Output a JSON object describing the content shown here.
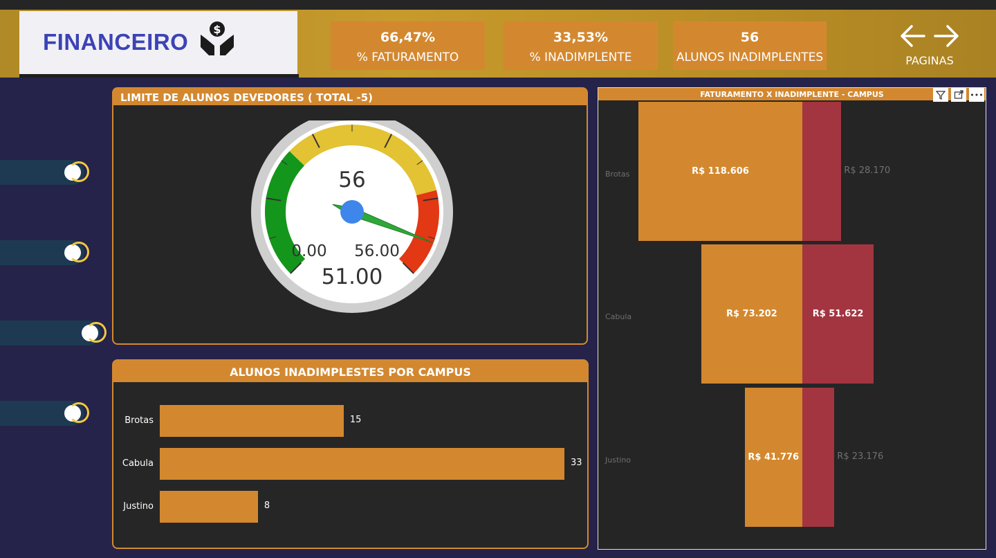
{
  "header": {
    "title": "FINANCEIRO",
    "kpis": [
      {
        "value": "66,47%",
        "label": "% FATURAMENTO"
      },
      {
        "value": "33,53%",
        "label": "% INADIMPLENTE"
      },
      {
        "value": "56",
        "label": "ALUNOS INADIMPLENTES"
      }
    ],
    "nav_label": "PAGINAS"
  },
  "gauge": {
    "title": "LIMITE DE ALUNOS DEVEDORES ( TOTAL  -5)",
    "value": "56",
    "min_label": "0.00",
    "max_label": "56.00",
    "target_label": "51.00",
    "min": 0,
    "max": 56,
    "current": 56,
    "target": 51
  },
  "bar_panel": {
    "title": "ALUNOS INADIMPLESTES POR CAMPUS"
  },
  "chart_data": [
    {
      "type": "bar",
      "title": "ALUNOS INADIMPLESTES POR CAMPUS",
      "categories": [
        "Brotas",
        "Cabula",
        "Justino"
      ],
      "values": [
        15,
        33,
        8
      ],
      "value_labels": [
        "15",
        "33",
        "8"
      ],
      "orientation": "horizontal"
    },
    {
      "type": "bar",
      "title": "FATURAMENTO X INADIMPLENTE - CAMPUS",
      "categories": [
        "Brotas",
        "Cabula",
        "Justino"
      ],
      "series": [
        {
          "values": [
            118606,
            73202,
            41776
          ],
          "labels": [
            "R$ 118.606",
            "R$ 73.202",
            "R$ 41.776"
          ],
          "color": "#d3882f"
        },
        {
          "values": [
            28170,
            51622,
            23176
          ],
          "labels": [
            "R$ 28.170",
            "R$ 51.622",
            "R$ 23.176"
          ],
          "color": "#a33540"
        }
      ]
    }
  ],
  "colors": {
    "accent": "#d3882f",
    "inadimplente": "#a33540",
    "brand_text": "#3c43b5"
  }
}
